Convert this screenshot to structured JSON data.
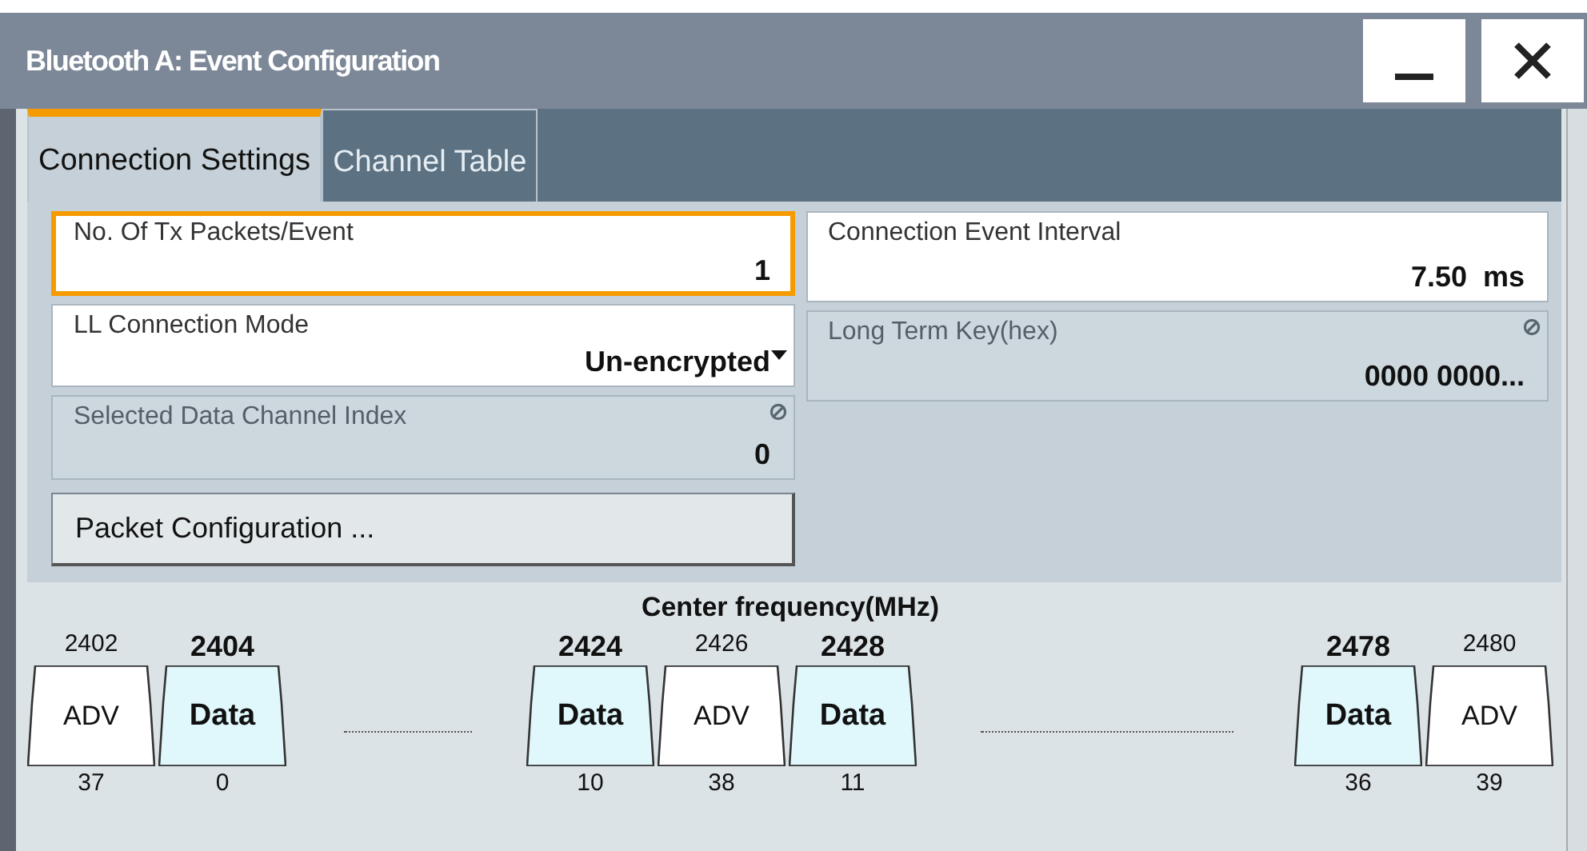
{
  "window": {
    "title": "Bluetooth A: Event Configuration",
    "buttons": [
      {
        "kind": "minimize"
      },
      {
        "kind": "close"
      }
    ]
  },
  "tabs": [
    {
      "label": "Connection Settings",
      "selected": true
    },
    {
      "label": "Channel Table",
      "selected": false
    }
  ],
  "left_fields": [
    {
      "kind": "field",
      "label": "No. Of Tx Packets/Event",
      "value": "1",
      "focused": true,
      "disabled": false
    },
    {
      "kind": "dropdown",
      "label": "LL Connection Mode",
      "value": "Un-encrypted",
      "focused": false,
      "disabled": false
    },
    {
      "kind": "field",
      "label": "Selected Data Channel Index",
      "value": "0",
      "focused": false,
      "disabled": true
    },
    {
      "kind": "button",
      "label": "Packet Configuration ..."
    }
  ],
  "right_fields": [
    {
      "kind": "field",
      "label": "Connection Event Interval",
      "value": "7.50  ms",
      "focused": false,
      "disabled": false
    },
    {
      "kind": "field",
      "label": "Long Term Key(hex)",
      "value": "0000 0000...",
      "focused": false,
      "disabled": true
    }
  ],
  "channel_map": {
    "title": "Center frequency(MHz)",
    "items": [
      {
        "kind": "adv",
        "frequency": "2402",
        "label": "ADV",
        "index": "37"
      },
      {
        "kind": "data",
        "frequency": "2404",
        "label": "Data",
        "index": "0"
      },
      {
        "kind": "gap",
        "wide": false
      },
      {
        "kind": "data",
        "frequency": "2424",
        "label": "Data",
        "index": "10"
      },
      {
        "kind": "adv",
        "frequency": "2426",
        "label": "ADV",
        "index": "38"
      },
      {
        "kind": "data",
        "frequency": "2428",
        "label": "Data",
        "index": "11"
      },
      {
        "kind": "gap",
        "wide": true
      },
      {
        "kind": "data",
        "frequency": "2478",
        "label": "Data",
        "index": "36"
      },
      {
        "kind": "adv",
        "frequency": "2480",
        "label": "ADV",
        "index": "39"
      }
    ]
  }
}
